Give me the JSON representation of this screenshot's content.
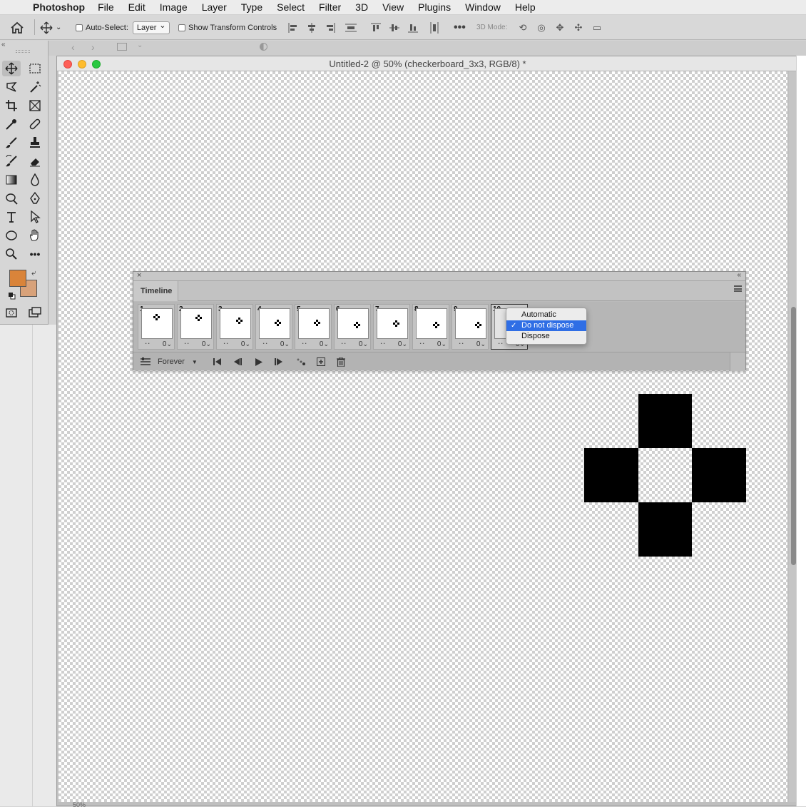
{
  "menubar": {
    "app_name": "Photoshop",
    "items": [
      "File",
      "Edit",
      "Image",
      "Layer",
      "Type",
      "Select",
      "Filter",
      "3D",
      "View",
      "Plugins",
      "Window",
      "Help"
    ]
  },
  "options_bar": {
    "auto_select_label": "Auto-Select:",
    "auto_select_value": "Layer",
    "show_transform_label": "Show Transform Controls",
    "mode_label": "3D Mode:"
  },
  "colors": {
    "foreground": "#d9843a",
    "background": "#d8a27a",
    "selection": "#2f6ee5"
  },
  "document": {
    "title": "Untitled-2 @ 50% (checkerboard_3x3, RGB/8) *",
    "status_zoom": "50%"
  },
  "timeline": {
    "title": "Timeline",
    "loop_value": "Forever",
    "frames": [
      {
        "num": "1",
        "delay": "0",
        "thumb": "s1"
      },
      {
        "num": "2",
        "delay": "0",
        "thumb": "s2"
      },
      {
        "num": "3",
        "delay": "0",
        "thumb": "s3"
      },
      {
        "num": "4",
        "delay": "0",
        "thumb": "s4"
      },
      {
        "num": "5",
        "delay": "0",
        "thumb": "s5"
      },
      {
        "num": "6",
        "delay": "0",
        "thumb": "s6"
      },
      {
        "num": "7",
        "delay": "0",
        "thumb": "s7"
      },
      {
        "num": "8",
        "delay": "0",
        "thumb": "s8"
      },
      {
        "num": "9",
        "delay": "0",
        "thumb": "s9"
      },
      {
        "num": "10",
        "delay": "0",
        "thumb": ""
      }
    ]
  },
  "disposal_menu": {
    "items": [
      "Automatic",
      "Do not dispose",
      "Dispose"
    ],
    "selected_index": 1
  }
}
